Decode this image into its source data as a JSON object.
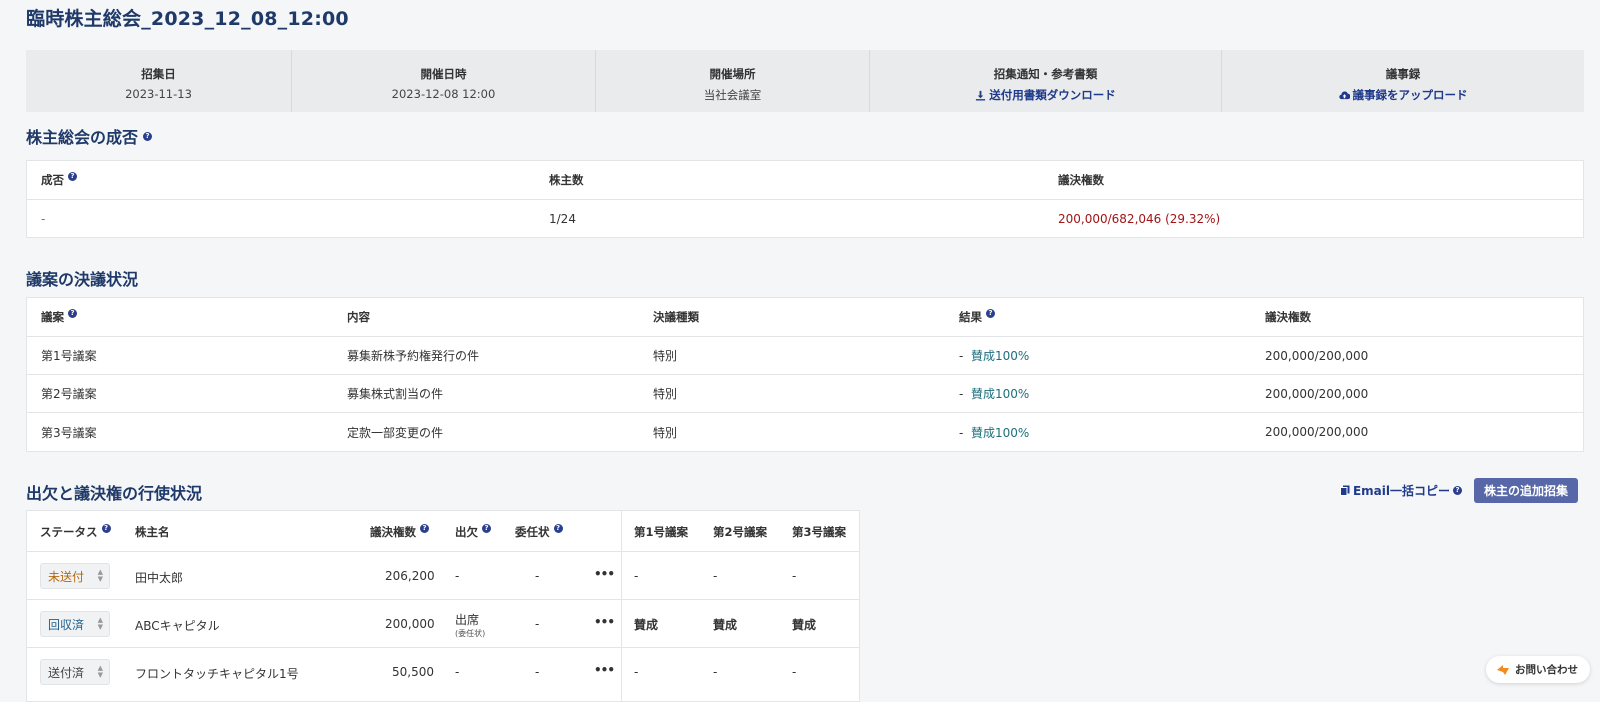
{
  "page": {
    "title": "臨時株主総会_2023_12_08_12:00"
  },
  "info": {
    "convocation_label": "招集日",
    "convocation_value": "2023-11-13",
    "datetime_label": "開催日時",
    "datetime_value": "2023-12-08 12:00",
    "venue_label": "開催場所",
    "venue_value": "当社会議室",
    "notice_label": "招集通知・参考書類",
    "notice_link": "送付用書類ダウンロード",
    "minutes_label": "議事録",
    "minutes_link": "議事録をアップロード"
  },
  "quorum": {
    "title": "株主総会の成否",
    "headers": {
      "result": "成否",
      "shareholders": "株主数",
      "votes": "議決権数"
    },
    "row": {
      "result": "-",
      "shareholders": "1/24",
      "votes": "200,000/682,046 (29.32%)"
    }
  },
  "resolutions": {
    "title": "議案の決議状況",
    "headers": {
      "proposal": "議案",
      "content": "内容",
      "type": "決議種類",
      "result": "結果",
      "votes": "議決権数"
    },
    "rows": [
      {
        "proposal": "第1号議案",
        "content": "募集新株予約権発行の件",
        "type": "特別",
        "result_dash": "-",
        "result": "賛成100%",
        "votes": "200,000/200,000"
      },
      {
        "proposal": "第2号議案",
        "content": "募集株式割当の件",
        "type": "特別",
        "result_dash": "-",
        "result": "賛成100%",
        "votes": "200,000/200,000"
      },
      {
        "proposal": "第3号議案",
        "content": "定款一部変更の件",
        "type": "特別",
        "result_dash": "-",
        "result": "賛成100%",
        "votes": "200,000/200,000"
      }
    ]
  },
  "attendance": {
    "title": "出欠と議決権の行使状況",
    "email_copy": "Email一括コピー",
    "add_button": "株主の追加招集",
    "headers": {
      "status": "ステータス",
      "name": "株主名",
      "votes": "議決権数",
      "attend": "出欠",
      "proxy": "委任状",
      "p1": "第1号議案",
      "p2": "第2号議案",
      "p3": "第3号議案"
    },
    "rows": [
      {
        "status": "未送付",
        "status_color": "#b4690e",
        "name": "田中太郎",
        "votes": "206,200",
        "attend": "-",
        "attend_sub": "",
        "proxy": "-",
        "more": "•••",
        "p1": "-",
        "p2": "-",
        "p3": "-"
      },
      {
        "status": "回収済",
        "status_color": "#1d5f8c",
        "name": "ABCキャピタル",
        "votes": "200,000",
        "attend": "出席",
        "attend_sub": "(委任状)",
        "proxy": "-",
        "more": "•••",
        "p1": "賛成",
        "p2": "賛成",
        "p3": "賛成"
      },
      {
        "status": "送付済",
        "status_color": "#444444",
        "name": "フロントタッチキャピタル1号",
        "votes": "50,500",
        "attend": "-",
        "attend_sub": "",
        "proxy": "-",
        "more": "•••",
        "p1": "-",
        "p2": "-",
        "p3": "-"
      }
    ]
  },
  "contact": {
    "label": "お問い合わせ"
  },
  "icons": {
    "help": "?",
    "download": "download-icon",
    "upload": "cloud-upload-icon",
    "copy": "copy-icon",
    "chat": "chat-icon"
  }
}
